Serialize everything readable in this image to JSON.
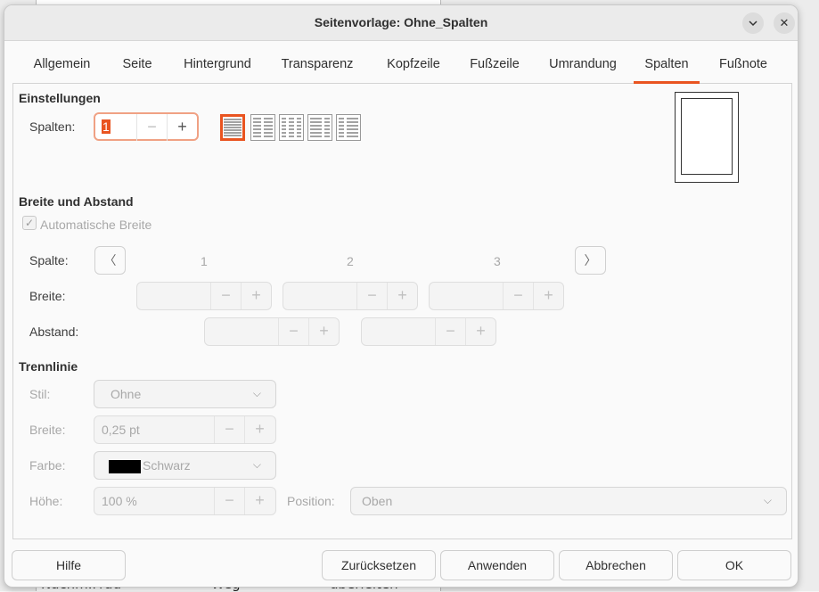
{
  "background_doc": {
    "text_left": "Nachm.Frau",
    "text_mid": "Weg",
    "text_right": "überleiten"
  },
  "dialog": {
    "title": "Seitenvorlage: Ohne_Spalten",
    "accent": "#e95420"
  },
  "tabs": [
    {
      "label": "Allgemein"
    },
    {
      "label": "Seite"
    },
    {
      "label": "Hintergrund"
    },
    {
      "label": "Transparenz"
    },
    {
      "label": "Kopfzeile"
    },
    {
      "label": "Fußzeile"
    },
    {
      "label": "Umrandung"
    },
    {
      "label": "Spalten"
    },
    {
      "label": "Fußnote"
    }
  ],
  "active_tab": "Spalten",
  "einstellungen": {
    "heading": "Einstellungen",
    "spalten_label": "Spalten:",
    "spalten_value": "1",
    "presets": [
      "1 Spalte",
      "2 Spalten",
      "3 Spalten",
      "2 Spalten links",
      "2 Spalten rechts"
    ]
  },
  "breite_abstand": {
    "heading": "Breite und Abstand",
    "auto_width_label": "Automatische Breite",
    "auto_width_checked": true,
    "spalte_label": "Spalte:",
    "col_numbers": [
      "1",
      "2",
      "3"
    ],
    "breite_label": "Breite:",
    "abstand_label": "Abstand:"
  },
  "trennlinie": {
    "heading": "Trennlinie",
    "stil_label": "Stil:",
    "stil_value": "Ohne",
    "breite_label": "Breite:",
    "breite_value": "0,25 pt",
    "farbe_label": "Farbe:",
    "farbe_value": "Schwarz",
    "farbe_swatch": "#000000",
    "hoehe_label": "Höhe:",
    "hoehe_value": "100 %",
    "position_label": "Position:",
    "position_value": "Oben"
  },
  "buttons": {
    "help": "Hilfe",
    "reset": "Zurücksetzen",
    "apply": "Anwenden",
    "cancel": "Abbrechen",
    "ok": "OK"
  },
  "icons": {
    "minus": "−",
    "plus": "+",
    "prev": "〈",
    "next": "〉",
    "chevron": "⌵",
    "close": "✕",
    "checkmark": "✓"
  }
}
